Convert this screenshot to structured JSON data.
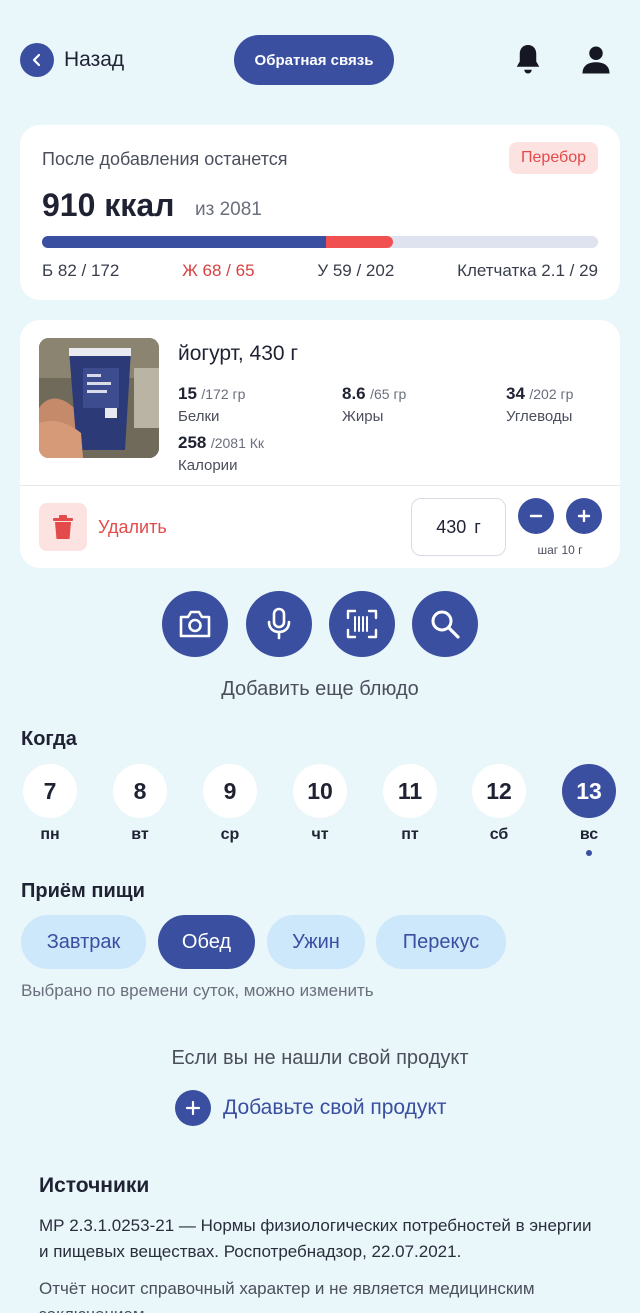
{
  "header": {
    "back_label": "Назад",
    "feedback_label": "Обратная связь"
  },
  "summary": {
    "caption": "После добавления останется",
    "badge": "Перебор",
    "remaining": "910 ккал",
    "of_total": "из 2081",
    "progress_fraction": 0.51,
    "progress_over_fraction": 0.12,
    "macros": {
      "protein": "Б 82 / 172",
      "fat": "Ж 68 / 65",
      "carbs": "У 59 / 202",
      "fiber": "Клетчатка 2.1 / 29"
    }
  },
  "product": {
    "name": "йогурт, 430 г",
    "protein": {
      "value": "15",
      "total": "/172 гр",
      "label": "Белки"
    },
    "fat": {
      "value": "8.6",
      "total": "/65 гр",
      "label": "Жиры"
    },
    "carbs": {
      "value": "34",
      "total": "/202 гр",
      "label": "Углеводы"
    },
    "calories": {
      "value": "258",
      "total": "/2081 Кк",
      "label": "Калории"
    },
    "delete_label": "Удалить",
    "quantity": "430",
    "unit": "г",
    "step_note": "шаг 10 г"
  },
  "add_more_label": "Добавить еще блюдо",
  "when": {
    "title": "Когда",
    "days": [
      {
        "num": "7",
        "wd": "пн"
      },
      {
        "num": "8",
        "wd": "вт"
      },
      {
        "num": "9",
        "wd": "ср"
      },
      {
        "num": "10",
        "wd": "чт"
      },
      {
        "num": "11",
        "wd": "пт"
      },
      {
        "num": "12",
        "wd": "сб"
      },
      {
        "num": "13",
        "wd": "вс"
      }
    ],
    "selected": "13"
  },
  "meal": {
    "title": "Приём пищи",
    "options": [
      "Завтрак",
      "Обед",
      "Ужин",
      "Перекус"
    ],
    "selected": "Обед",
    "hint": "Выбрано по времени суток, можно изменить"
  },
  "not_found": {
    "text": "Если вы не нашли свой продукт",
    "add_label": "Добавьте свой продукт"
  },
  "sources": {
    "title": "Источники",
    "text": "МР 2.3.1.0253-21 — Нормы физиологических потребностей в энергии и пищевых веществах. Роспотребнадзор, 22.07.2021.",
    "disclaimer": "Отчёт носит справочный характер и не является медицинским заключением."
  },
  "colors": {
    "primary": "#3a4fa0",
    "danger": "#e34a4a",
    "background": "#e9f6fa",
    "chip": "#cde7fb"
  }
}
